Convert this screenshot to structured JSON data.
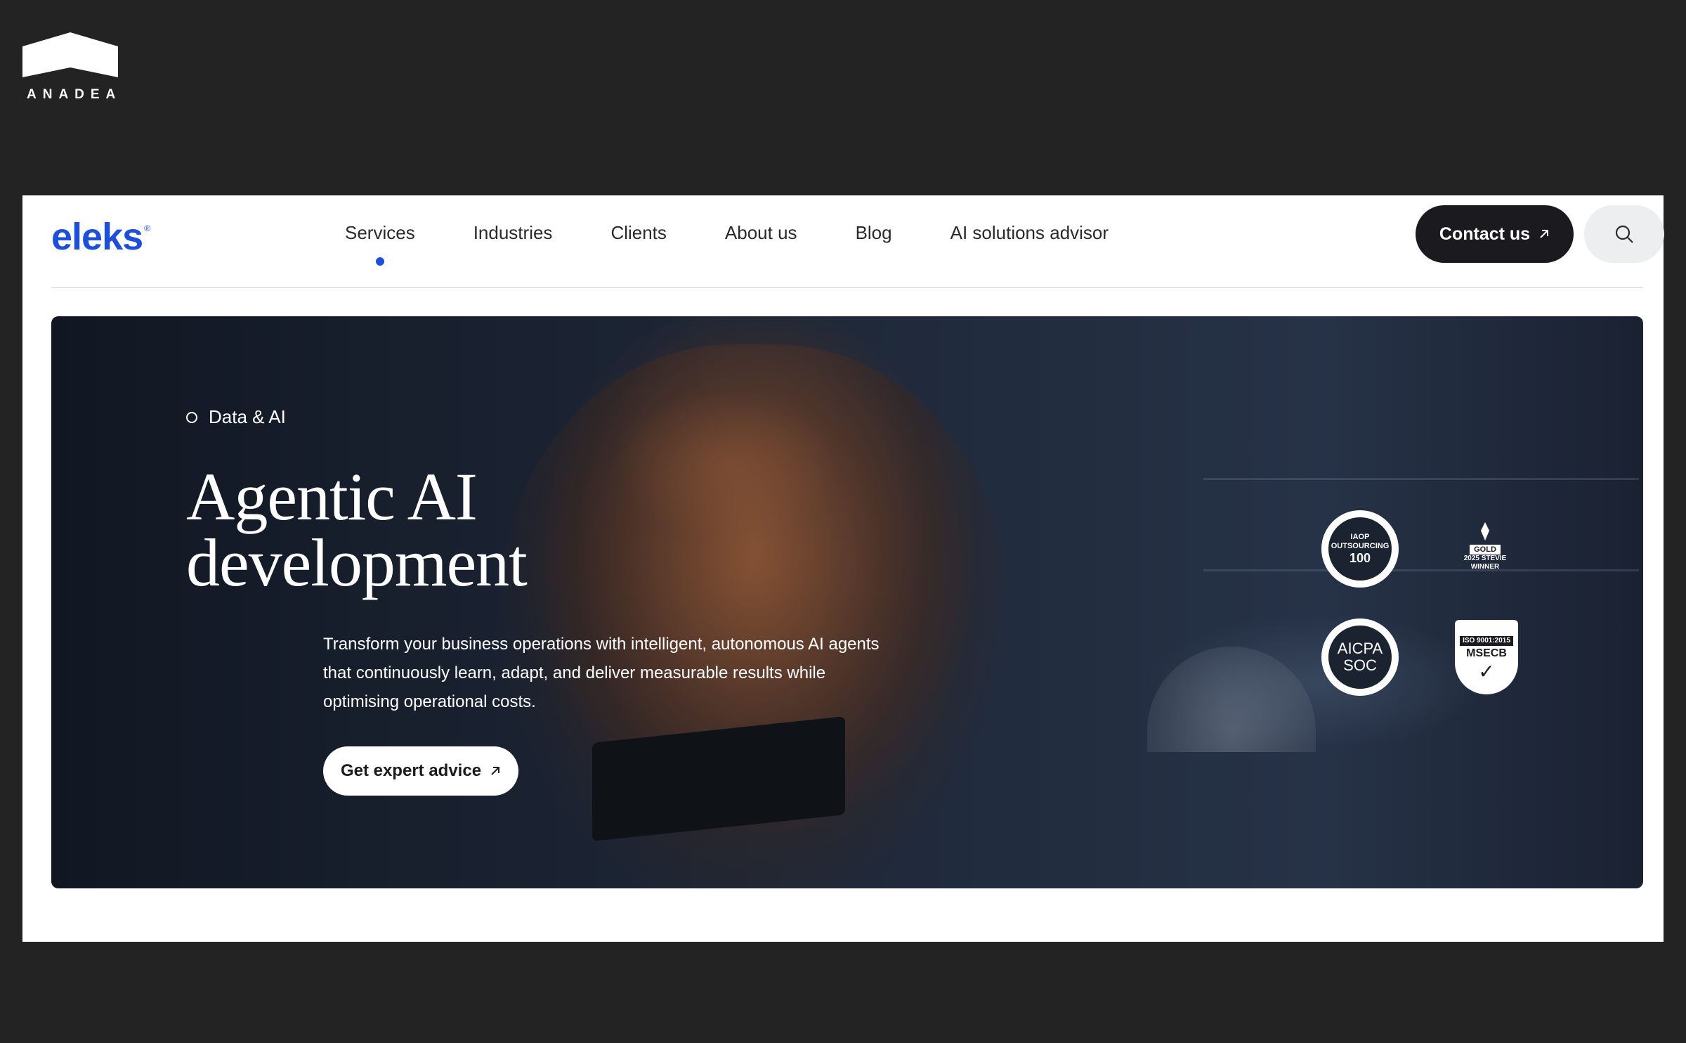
{
  "watermark": {
    "brand": "ANADEA"
  },
  "header": {
    "logo_text": "eleks",
    "logo_mark": "®",
    "nav": [
      {
        "label": "Services",
        "active": true
      },
      {
        "label": "Industries",
        "active": false
      },
      {
        "label": "Clients",
        "active": false
      },
      {
        "label": "About us",
        "active": false
      },
      {
        "label": "Blog",
        "active": false
      },
      {
        "label": "AI solutions advisor",
        "active": false
      }
    ],
    "contact_label": "Contact us",
    "contact_icon": "arrow-up-right-icon",
    "search_icon": "search-icon"
  },
  "hero": {
    "eyebrow": "Data & AI",
    "title_line1": "Agentic AI",
    "title_line2": "development",
    "description": "Transform your business operations with intelligent, autonomous AI agents that continuously learn, adapt, and deliver measurable results while optimising operational costs.",
    "cta_label": "Get expert advice",
    "cta_icon": "arrow-up-right-icon"
  },
  "badges": {
    "iaop": {
      "top": "IAOP",
      "main": "OUTSOURCING",
      "num": "100"
    },
    "stevie": {
      "line1": "GOLD",
      "line2": "2025 STEVIE",
      "line3": "WINNER"
    },
    "aicpa": {
      "line1": "AICPA",
      "line2": "SOC"
    },
    "iso": {
      "line1": "ISO 9001:2015",
      "line2": "MSECB"
    }
  },
  "colors": {
    "accent_blue": "#1e4fd8",
    "dark_button": "#1b1b1f",
    "page_background": "#232323"
  }
}
